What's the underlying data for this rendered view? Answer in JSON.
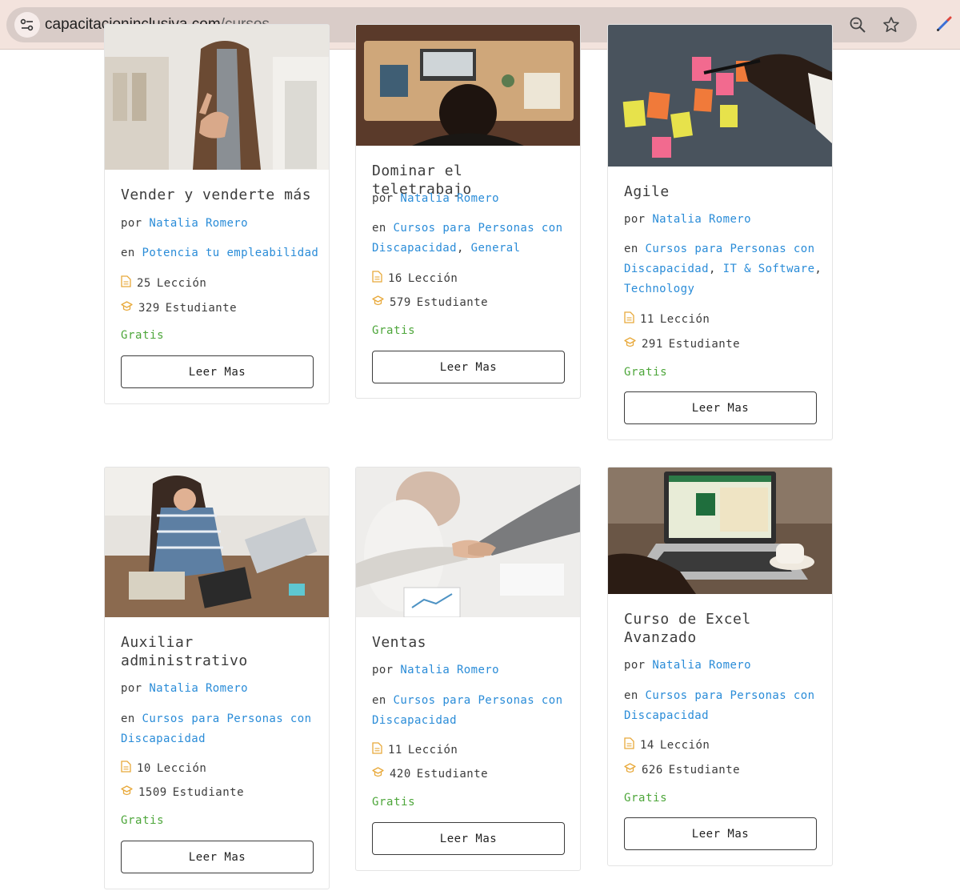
{
  "browser": {
    "url_domain": "capacitacioninclusiva.com",
    "url_path": "/cursos",
    "icons": [
      "site-settings-icon",
      "zoom-icon",
      "bookmark-star-icon",
      "extension-pen-icon"
    ]
  },
  "common": {
    "by_prefix": "por",
    "in_prefix": "en",
    "lessons_suffix": "Lección",
    "students_suffix": "Estudiante",
    "price": "Gratis",
    "button_label": "Leer Mas"
  },
  "colors": {
    "link": "#2a8cd8",
    "price": "#4da63a",
    "icon": "#e8a93a"
  },
  "courses": [
    {
      "title": "Vender y venderte más",
      "author": "Natalia Romero",
      "categories": [
        "Potencia tu empleabilidad"
      ],
      "lessons": "25",
      "students": "329"
    },
    {
      "title": "Dominar el teletrabajo",
      "author": "Natalia Romero",
      "categories": [
        "Cursos para Personas con Discapacidad",
        "General"
      ],
      "lessons": "16",
      "students": "579"
    },
    {
      "title": "Agile",
      "author": "Natalia Romero",
      "categories": [
        "Cursos para Personas con Discapacidad",
        "IT & Software",
        "Technology"
      ],
      "lessons": "11",
      "students": "291"
    },
    {
      "title": "Auxiliar administrativo",
      "author": "Natalia Romero",
      "categories": [
        "Cursos para Personas con Discapacidad"
      ],
      "lessons": "10",
      "students": "1509"
    },
    {
      "title": "Ventas",
      "author": "Natalia Romero",
      "categories": [
        "Cursos para Personas con Discapacidad"
      ],
      "lessons": "11",
      "students": "420"
    },
    {
      "title": "Curso de Excel Avanzado",
      "author": "Natalia Romero",
      "categories": [
        "Cursos para Personas con Discapacidad"
      ],
      "lessons": "14",
      "students": "626"
    }
  ]
}
